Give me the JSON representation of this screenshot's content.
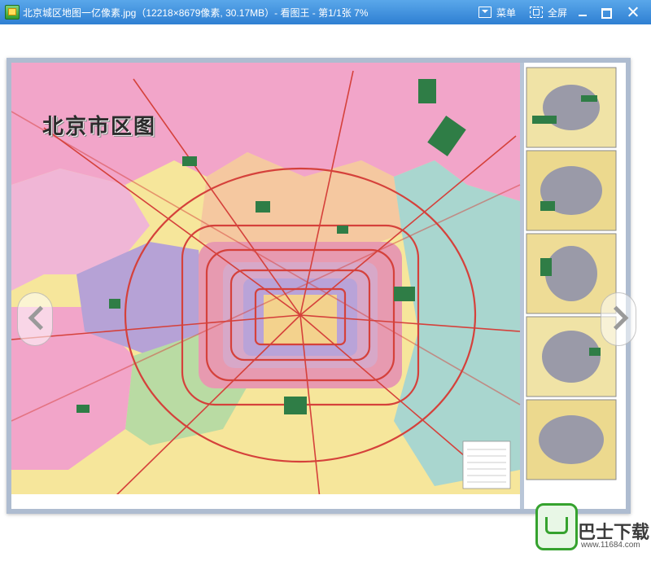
{
  "window": {
    "title": "北京城区地图一亿像素.jpg（12218×8679像素, 30.17MB）- 看图王 - 第1/1张 7%",
    "menu_label": "菜单",
    "fullscreen_label": "全屏"
  },
  "map": {
    "title": "北京市区图"
  },
  "watermark": {
    "site_name": "巴士下载",
    "url": "www.11684.com"
  },
  "colors": {
    "titlebar": "#3a8ddf",
    "map_pink": "#f2a5c9",
    "map_yellow": "#f6e69b",
    "map_teal": "#a9d6cf",
    "map_purple": "#b6a2d6",
    "road_red": "#d5413b"
  },
  "icons": {
    "app": "image-viewer-app-icon",
    "menu": "menu-dropdown-icon",
    "fullscreen": "fullscreen-icon",
    "minimize": "minimize-icon",
    "maximize": "maximize-icon",
    "close": "close-icon",
    "prev": "chevron-left-icon",
    "next": "chevron-right-icon"
  }
}
